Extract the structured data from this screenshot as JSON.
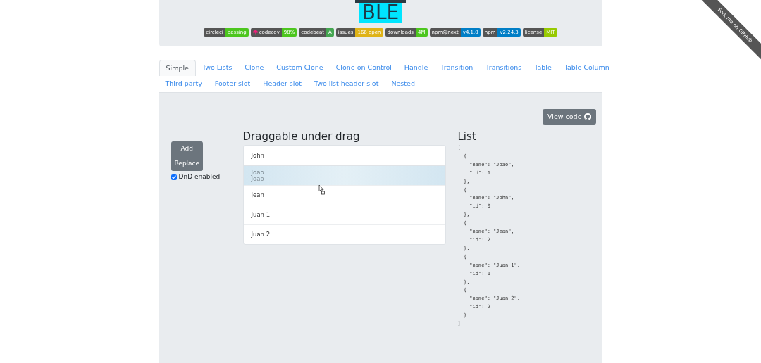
{
  "logo": {
    "text": "BLE"
  },
  "badges": [
    {
      "label": "circleci",
      "value": "passing",
      "color": "#4cc61e",
      "icon": false
    },
    {
      "label": "codecov",
      "value": "98%",
      "color": "#4cc61e",
      "icon": true
    },
    {
      "label": "codebeat",
      "value": "A",
      "color": "#44a651",
      "icon": false
    },
    {
      "label": "issues",
      "value": "166 open",
      "color": "#dfb317",
      "icon": false
    },
    {
      "label": "downloads",
      "value": "4M",
      "color": "#4cc61e",
      "icon": false
    },
    {
      "label": "npm@next",
      "value": "v4.1.0",
      "color": "#007ec6",
      "icon": false
    },
    {
      "label": "npm",
      "value": "v2.24.3",
      "color": "#007ec6",
      "icon": false
    },
    {
      "label": "license",
      "value": "MIT",
      "color": "#97ca00",
      "icon": false
    }
  ],
  "ribbon": {
    "text": "Fork me on GitHub"
  },
  "tabs": [
    [
      {
        "label": "Simple",
        "selected": true
      },
      {
        "label": "Two Lists",
        "selected": false
      },
      {
        "label": "Clone",
        "selected": false
      },
      {
        "label": "Custom Clone",
        "selected": false
      },
      {
        "label": "Clone on Control",
        "selected": false
      },
      {
        "label": "Handle",
        "selected": false
      },
      {
        "label": "Transition",
        "selected": false
      },
      {
        "label": "Transitions",
        "selected": false
      },
      {
        "label": "Table",
        "selected": false
      },
      {
        "label": "Table Column",
        "selected": false
      }
    ],
    [
      {
        "label": "Third party",
        "selected": false
      },
      {
        "label": "Footer slot",
        "selected": false
      },
      {
        "label": "Header slot",
        "selected": false
      },
      {
        "label": "Two list header slot",
        "selected": false
      },
      {
        "label": "Nested",
        "selected": false
      }
    ]
  ],
  "view_code": {
    "label": "View code"
  },
  "controls": {
    "buttons": [
      "Add",
      "Replace"
    ],
    "dnd": {
      "label": "DnD enabled",
      "checked": true
    }
  },
  "draggable": {
    "title": "Draggable under drag",
    "items": [
      {
        "name": "John",
        "dragging": false
      },
      {
        "name": "Joao",
        "ghost_name": "Joao",
        "dragging": true
      },
      {
        "name": "Jean",
        "dragging": false
      },
      {
        "name": "Juan 1",
        "dragging": false
      },
      {
        "name": "Juan 2",
        "dragging": false
      }
    ]
  },
  "list": {
    "title": "List",
    "json": "[\n  {\n    \"name\": \"Joao\",\n    \"id\": 1\n  },\n  {\n    \"name\": \"John\",\n    \"id\": 0\n  },\n  {\n    \"name\": \"Jean\",\n    \"id\": 2\n  },\n  {\n    \"name\": \"Juan 1\",\n    \"id\": 1\n  },\n  {\n    \"name\": \"Juan 2\",\n    \"id\": 2\n  }\n]"
  }
}
